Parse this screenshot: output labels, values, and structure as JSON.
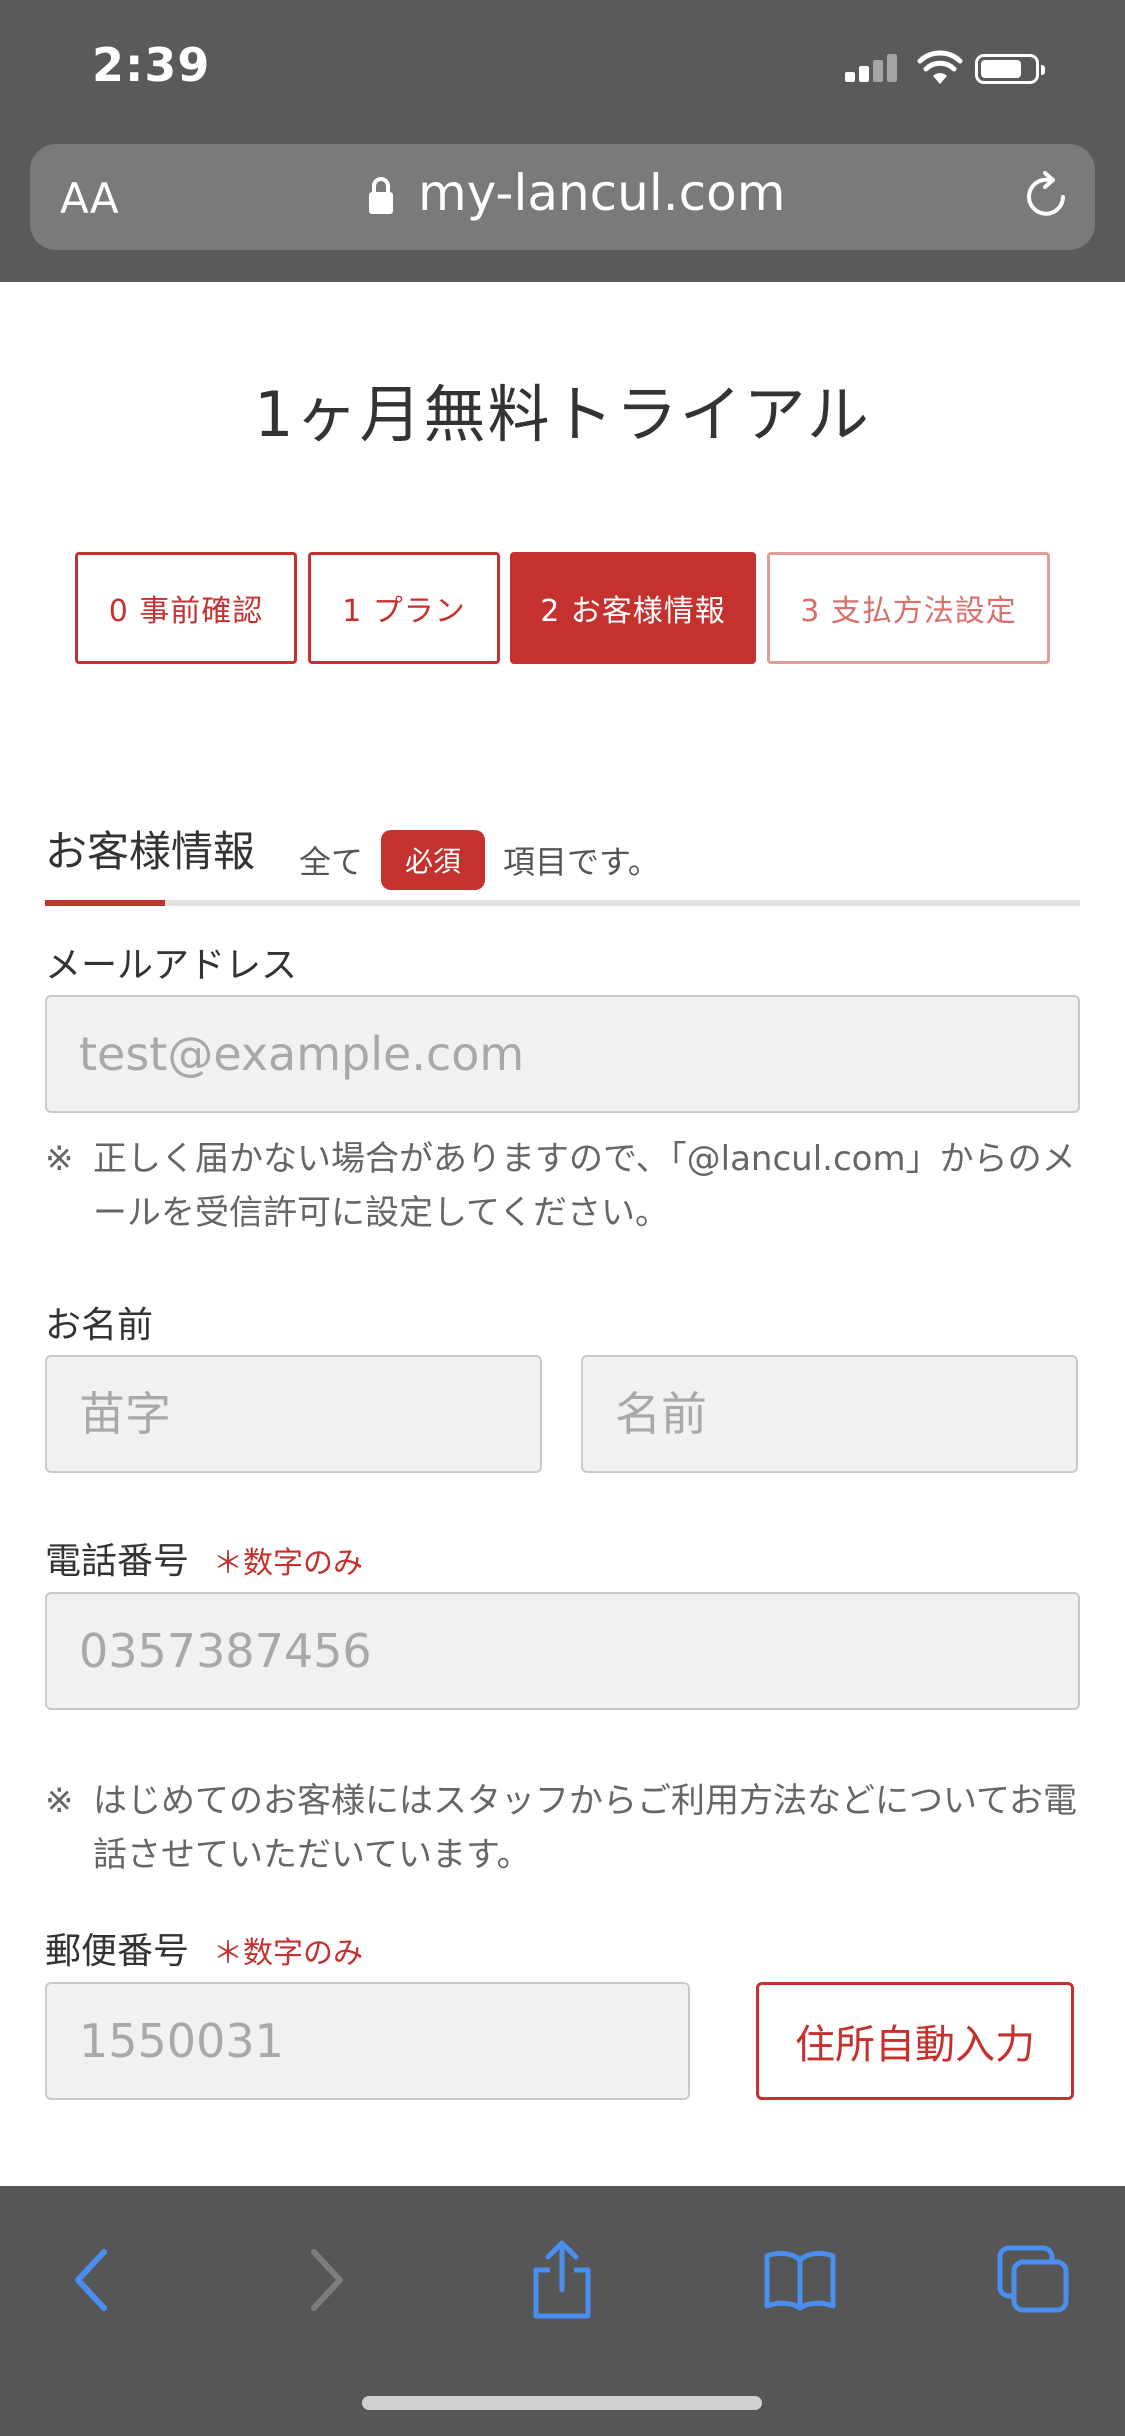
{
  "status": {
    "time": "2:39"
  },
  "browser": {
    "text_size_label": "AA",
    "url": "my-lancul.com"
  },
  "page": {
    "title": "1ヶ月無料トライアル"
  },
  "steps": [
    {
      "label": "0 事前確認",
      "state": "done"
    },
    {
      "label": "1 プラン",
      "state": "done"
    },
    {
      "label": "2 お客様情報",
      "state": "active"
    },
    {
      "label": "3 支払方法設定",
      "state": "future"
    }
  ],
  "section": {
    "title": "お客様情報",
    "note_before": "全て",
    "required_badge": "必須",
    "note_after": "項目です。"
  },
  "form": {
    "email": {
      "label": "メールアドレス",
      "placeholder": "test@example.com",
      "note_mark": "※",
      "note": "正しく届かない場合がありますので、「@lancul.com」からのメールを受信許可に設定してください。"
    },
    "name": {
      "label": "お名前",
      "last_placeholder": "苗字",
      "first_placeholder": "名前"
    },
    "phone": {
      "label": "電話番号",
      "hint": "＊数字のみ",
      "placeholder": "0357387456",
      "note_mark": "※",
      "note": "はじめてのお客様にはスタッフからご利用方法などについてお電話させていただいています。"
    },
    "postal": {
      "label": "郵便番号",
      "hint": "＊数字のみ",
      "placeholder": "1550031",
      "autofill_button": "住所自動入力"
    }
  },
  "toolbar": {
    "icons": [
      "back-icon",
      "forward-icon",
      "share-icon",
      "bookmarks-icon",
      "tabs-icon"
    ],
    "accent": "#4a8ef0"
  },
  "colors": {
    "brand_red": "#c4312e"
  }
}
